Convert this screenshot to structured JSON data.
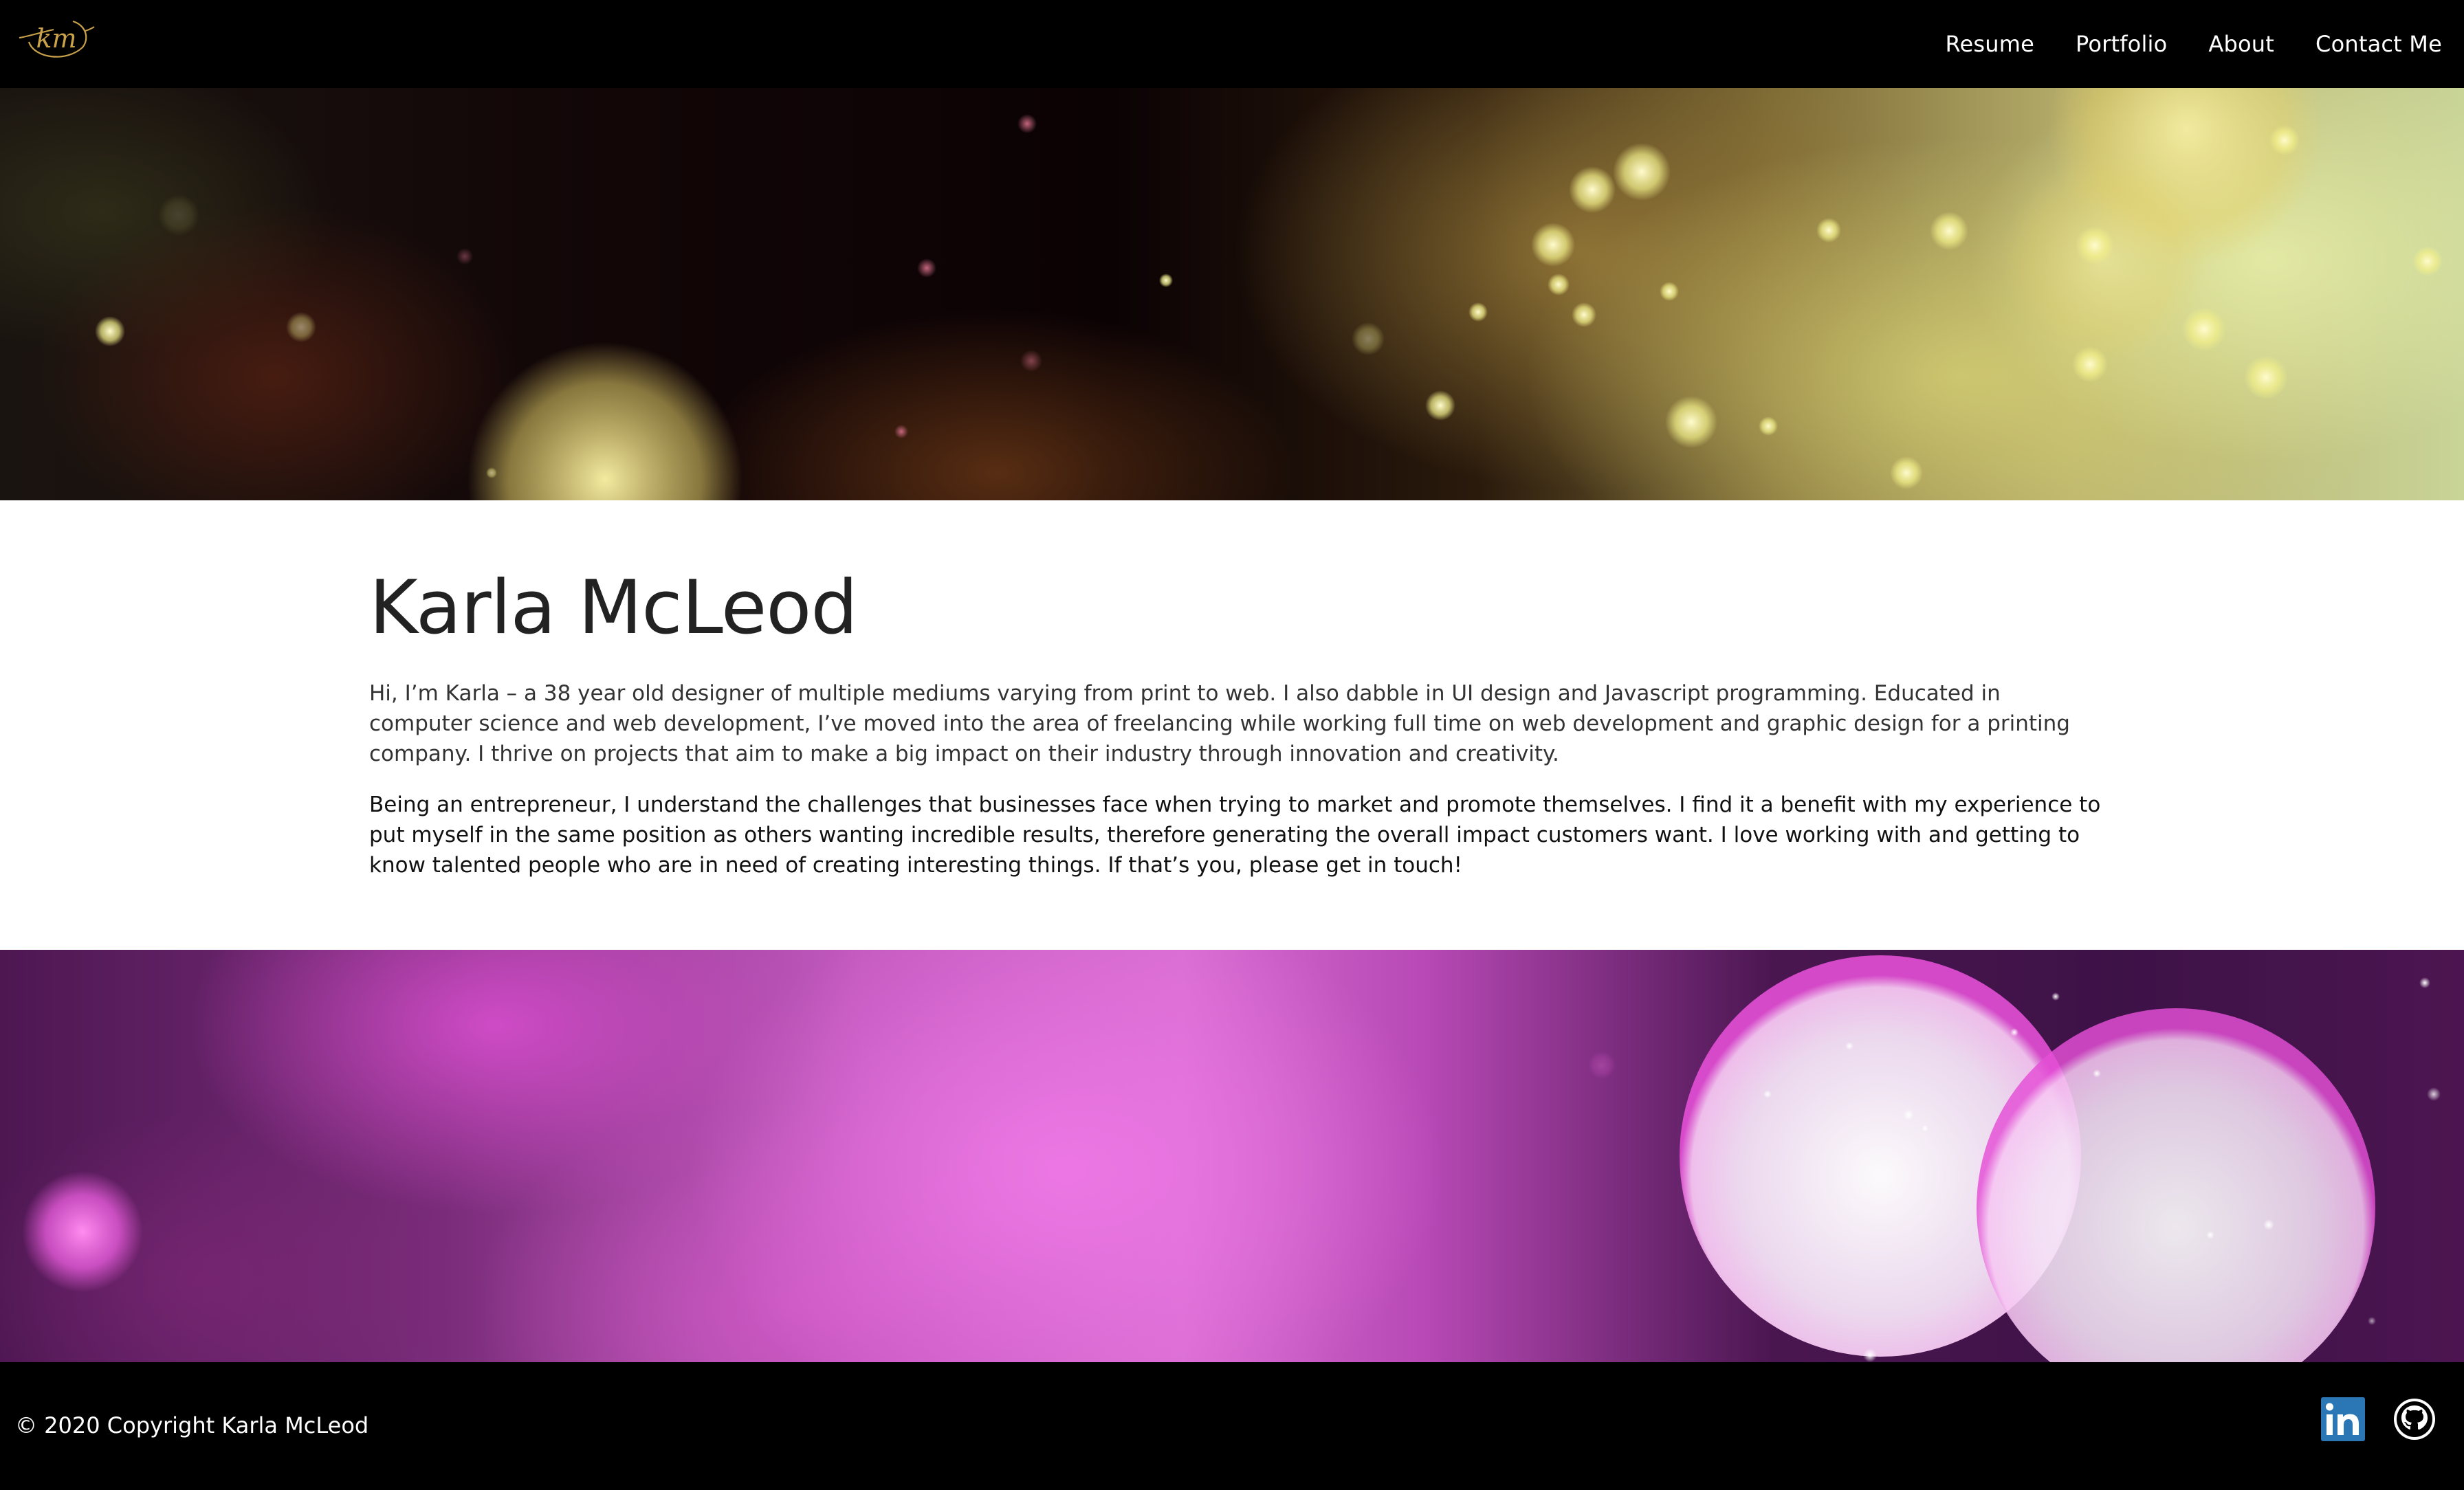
{
  "header": {
    "logo_text": "km",
    "nav": [
      {
        "label": "Resume"
      },
      {
        "label": "Portfolio"
      },
      {
        "label": "About"
      },
      {
        "label": "Contact Me"
      }
    ]
  },
  "main": {
    "title": "Karla McLeod",
    "paragraphs": [
      "Hi, I’m Karla – a 38 year old designer of multiple mediums varying from print to web. I also dabble in UI design and Javascript programming. Educated in computer science and web development, I’ve moved into the area of freelancing while working full time on web development and graphic design for a printing company. I thrive on projects that aim to make a big impact on their industry through innovation and creativity.",
      "Being an entrepreneur, I understand the challenges that businesses face when trying to market and promote themselves. I find it a benefit with my experience to put myself in the same position as others wanting incredible results, therefore generating the overall impact customers want. I love working with and getting to know talented people who are in need of creating interesting things. If that’s you, please get in touch!"
    ]
  },
  "footer": {
    "copyright": "© 2020 Copyright Karla McLeod",
    "social": [
      {
        "icon": "linkedin-icon"
      },
      {
        "icon": "github-icon"
      }
    ]
  },
  "colors": {
    "nav_bg": "#000000",
    "logo_gold": "#c9a24a",
    "linkedin_blue": "#2b77b5"
  }
}
